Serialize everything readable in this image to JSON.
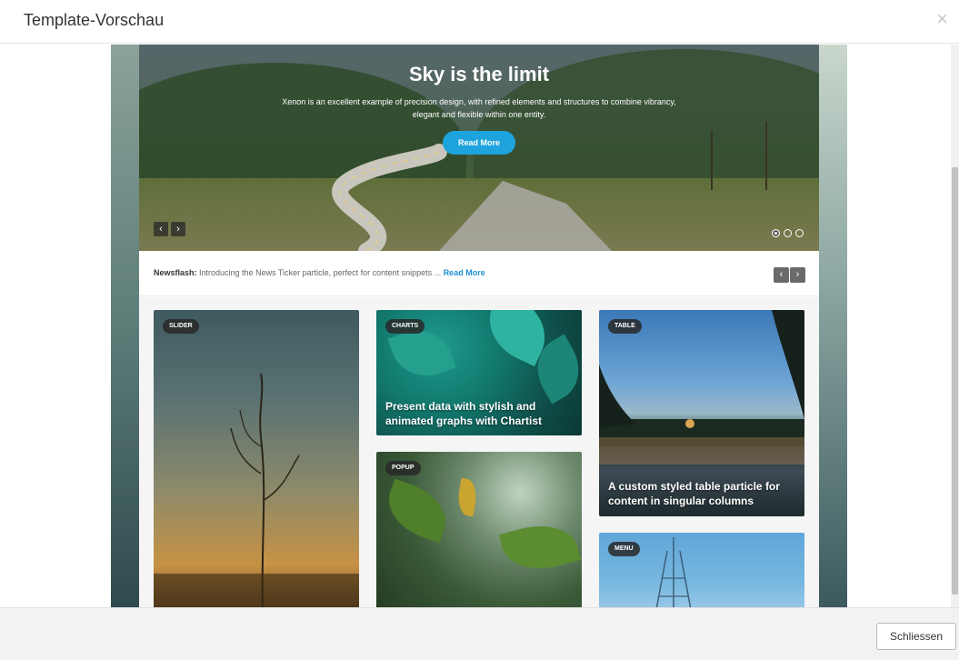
{
  "dialog": {
    "title": "Template-Vorschau",
    "close_symbol": "×",
    "close_button_label": "Schliessen"
  },
  "hero": {
    "title": "Sky is the limit",
    "text": "Xenon is an excellent example of precision design, with refined elements and structures to combine vibrancy, elegant and flexible within one entity.",
    "button_label": "Read More",
    "prev_symbol": "‹",
    "next_symbol": "›",
    "slide_count": 3,
    "active_slide": 1
  },
  "newsflash": {
    "label": "Newsflash:",
    "text": "Introducing the News Ticker particle, perfect for content snippets ...",
    "link": "Read More",
    "prev_symbol": "‹",
    "next_symbol": "›"
  },
  "cards": {
    "slider": {
      "tag": "SLIDER"
    },
    "charts": {
      "tag": "CHARTS",
      "caption_line1": "Present data with stylish and",
      "caption_line2": "animated graphs with Chartist"
    },
    "table": {
      "tag": "TABLE",
      "caption_line1": "A custom styled table particle for",
      "caption_line2": "content in singular columns"
    },
    "popup": {
      "tag": "POPUP"
    },
    "menu": {
      "tag": "MENU"
    }
  },
  "colors": {
    "accent": "#1fa3dc",
    "link": "#1f8fd0"
  }
}
